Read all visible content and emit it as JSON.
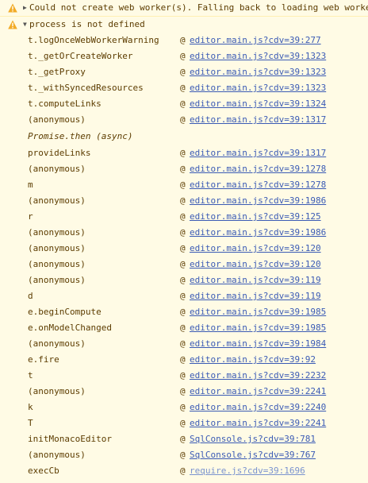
{
  "messages": [
    {
      "level": "warning",
      "expanded": false,
      "text": "Could not create web worker(s). Falling back to loading web worke"
    },
    {
      "level": "warning",
      "expanded": true,
      "text": "process is not defined"
    }
  ],
  "stack_frames_1": [
    {
      "fn": "t.logOnceWebWorkerWarning",
      "loc": "editor.main.js?cdv=39:277"
    },
    {
      "fn": "t._getOrCreateWorker",
      "loc": "editor.main.js?cdv=39:1323"
    },
    {
      "fn": "t._getProxy",
      "loc": "editor.main.js?cdv=39:1323"
    },
    {
      "fn": "t._withSyncedResources",
      "loc": "editor.main.js?cdv=39:1323"
    },
    {
      "fn": "t.computeLinks",
      "loc": "editor.main.js?cdv=39:1324"
    },
    {
      "fn": "(anonymous)",
      "loc": "editor.main.js?cdv=39:1317"
    }
  ],
  "async_label": "Promise.then (async)",
  "stack_frames_2": [
    {
      "fn": "provideLinks",
      "loc": "editor.main.js?cdv=39:1317"
    },
    {
      "fn": "(anonymous)",
      "loc": "editor.main.js?cdv=39:1278"
    },
    {
      "fn": "m",
      "loc": "editor.main.js?cdv=39:1278"
    },
    {
      "fn": "(anonymous)",
      "loc": "editor.main.js?cdv=39:1986"
    },
    {
      "fn": "r",
      "loc": "editor.main.js?cdv=39:125"
    },
    {
      "fn": "(anonymous)",
      "loc": "editor.main.js?cdv=39:1986"
    },
    {
      "fn": "(anonymous)",
      "loc": "editor.main.js?cdv=39:120"
    },
    {
      "fn": "(anonymous)",
      "loc": "editor.main.js?cdv=39:120"
    },
    {
      "fn": "(anonymous)",
      "loc": "editor.main.js?cdv=39:119"
    },
    {
      "fn": "d",
      "loc": "editor.main.js?cdv=39:119"
    },
    {
      "fn": "e.beginCompute",
      "loc": "editor.main.js?cdv=39:1985"
    },
    {
      "fn": "e.onModelChanged",
      "loc": "editor.main.js?cdv=39:1985"
    },
    {
      "fn": "(anonymous)",
      "loc": "editor.main.js?cdv=39:1984"
    },
    {
      "fn": "e.fire",
      "loc": "editor.main.js?cdv=39:92"
    },
    {
      "fn": "t",
      "loc": "editor.main.js?cdv=39:2232"
    },
    {
      "fn": "(anonymous)",
      "loc": "editor.main.js?cdv=39:2241"
    },
    {
      "fn": "k",
      "loc": "editor.main.js?cdv=39:2240"
    },
    {
      "fn": "T",
      "loc": "editor.main.js?cdv=39:2241"
    },
    {
      "fn": "initMonacoEditor",
      "loc": "SqlConsole.js?cdv=39:781"
    },
    {
      "fn": "(anonymous)",
      "loc": "SqlConsole.js?cdv=39:767"
    },
    {
      "fn": "execCb",
      "loc": "require.js?cdv=39:1696",
      "dim": true
    }
  ],
  "colors": {
    "warning_bg": "#fffbe5",
    "warning_text": "#5c3c00",
    "link": "#3b5bb5",
    "warning_icon": "#f2ab26"
  },
  "icons": {
    "warning": "warning-triangle-icon",
    "collapsed": "triangle-right-icon",
    "expanded": "triangle-down-icon"
  }
}
